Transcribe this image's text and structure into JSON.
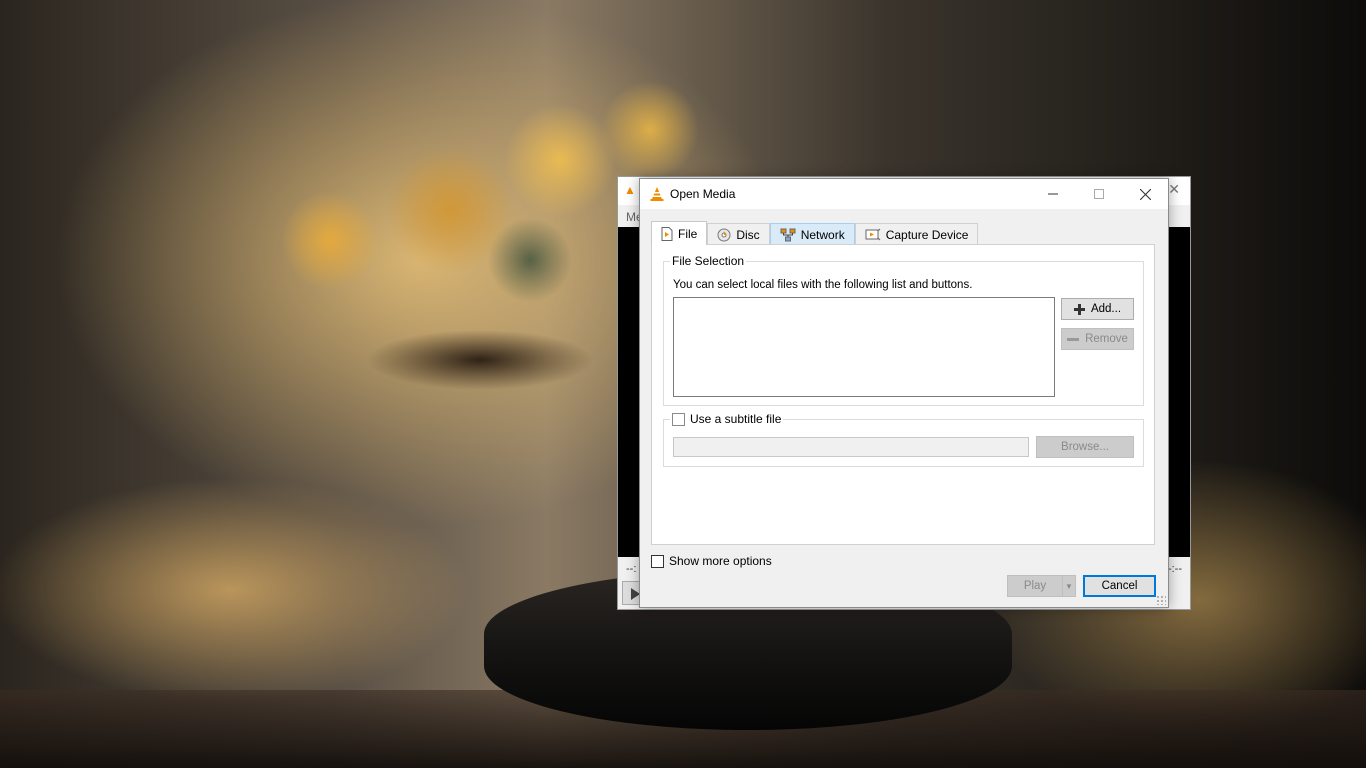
{
  "background_window": {
    "menu_fragment": "Me",
    "time_elapsed": "--:",
    "time_total": "--:--"
  },
  "dialog": {
    "title": "Open Media",
    "tabs": [
      {
        "label": "File",
        "icon": "file-icon",
        "active": true
      },
      {
        "label": "Disc",
        "icon": "disc-icon",
        "active": false
      },
      {
        "label": "Network",
        "icon": "network-icon",
        "active": false
      },
      {
        "label": "Capture Device",
        "icon": "capture-device-icon",
        "active": false
      }
    ],
    "file_selection": {
      "legend": "File Selection",
      "hint": "You can select local files with the following list and buttons.",
      "add_label": "Add...",
      "remove_label": "Remove"
    },
    "subtitle": {
      "checkbox_label": "Use a subtitle file",
      "checked": false,
      "path_value": "",
      "browse_label": "Browse..."
    },
    "show_more_options": {
      "label": "Show more options",
      "checked": false
    },
    "play_label": "Play",
    "cancel_label": "Cancel"
  },
  "colors": {
    "accent": "#0078d7",
    "vlc_orange": "#f08c00",
    "tab_hover": "#d9ebf9"
  }
}
